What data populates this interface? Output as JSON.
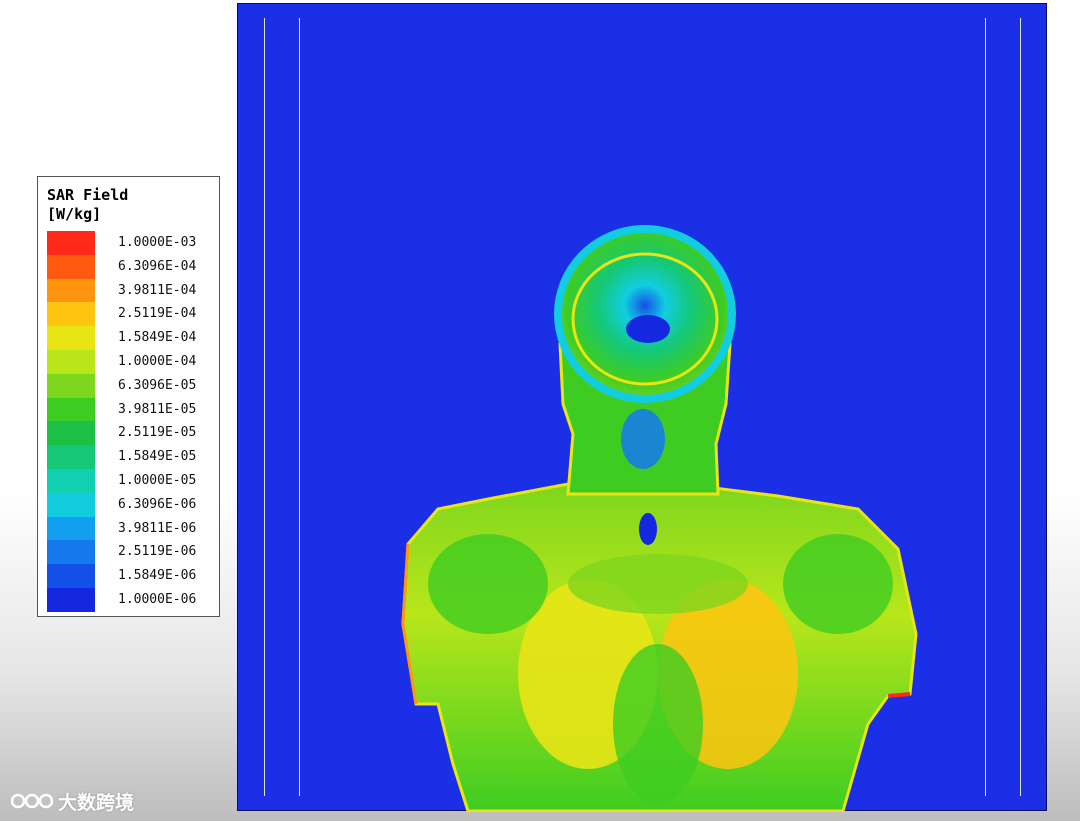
{
  "legend": {
    "title_line1": "SAR Field",
    "title_line2": "[W/kg]",
    "items": [
      {
        "label": "1.0000E-03",
        "color": "#ff2a1a"
      },
      {
        "label": "6.3096E-04",
        "color": "#ff5a10"
      },
      {
        "label": "3.9811E-04",
        "color": "#ff9410"
      },
      {
        "label": "2.5119E-04",
        "color": "#ffc410"
      },
      {
        "label": "1.5849E-04",
        "color": "#e8e416"
      },
      {
        "label": "1.0000E-04",
        "color": "#b8e61a"
      },
      {
        "label": "6.3096E-05",
        "color": "#7ed61e"
      },
      {
        "label": "3.9811E-05",
        "color": "#3fcc22"
      },
      {
        "label": "2.5119E-05",
        "color": "#1cc044"
      },
      {
        "label": "1.5849E-05",
        "color": "#14c878"
      },
      {
        "label": "1.0000E-05",
        "color": "#10d0b0"
      },
      {
        "label": "6.3096E-06",
        "color": "#12cde0"
      },
      {
        "label": "3.9811E-06",
        "color": "#149ef0"
      },
      {
        "label": "2.5119E-06",
        "color": "#1478ee"
      },
      {
        "label": "1.5849E-06",
        "color": "#1450e8"
      },
      {
        "label": "1.0000E-06",
        "color": "#1428e0"
      }
    ]
  },
  "viewport": {
    "background": "#1a2fe6"
  },
  "watermark": {
    "text": "大数跨境"
  }
}
